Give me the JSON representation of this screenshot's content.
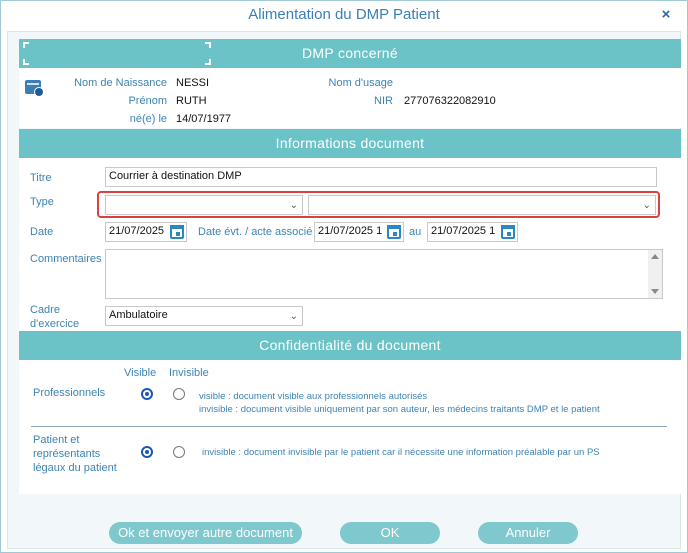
{
  "window": {
    "title": "Alimentation du DMP Patient",
    "close_glyph": "×"
  },
  "dmp": {
    "header": "DMP concerné",
    "labels": {
      "nom_naissance": "Nom de Naissance",
      "prenom": "Prénom",
      "ne_le": "né(e) le",
      "nom_usage": "Nom d'usage",
      "nir": "NIR"
    },
    "values": {
      "nom_naissance": "NESSI",
      "prenom": "RUTH",
      "ne_le": "14/07/1977",
      "nom_usage": "",
      "nir": "277076322082910"
    }
  },
  "doc": {
    "header": "Informations document",
    "titre_label": "Titre",
    "titre_value": "Courrier à destination DMP",
    "type_label": "Type",
    "type_value_1": "",
    "type_value_2": "",
    "date_label": "Date",
    "date_value": "21/07/2025",
    "date_evt_label": "Date évt. / acte associé",
    "date_evt_from": "21/07/2025 1",
    "au_label": "au",
    "date_evt_to": "21/07/2025 1",
    "commentaires_label": "Commentaires",
    "commentaires_value": "",
    "cadre_label_1": "Cadre",
    "cadre_label_2": "d'exercice",
    "cadre_value": "Ambulatoire"
  },
  "conf": {
    "header": "Confidentialité du document",
    "col_visible": "Visible",
    "col_invisible": "Invisible",
    "professionnels_label": "Professionnels",
    "prof_desc_1": "visible : document visible aux professionnels autorisés",
    "prof_desc_2": "invisible : document visible uniquement par son auteur, les médecins traitants DMP et le patient",
    "patient_label_1": "Patient et",
    "patient_label_2": "représentants",
    "patient_label_3": "légaux du patient",
    "patient_desc": "invisible : document invisible par le patient car il nécessite une information préalable par un PS"
  },
  "buttons": {
    "ok_send": "Ok et envoyer autre document",
    "ok": "OK",
    "cancel": "Annuler"
  },
  "colors": {
    "accent": "#6bc3c7",
    "label_blue": "#3c84b4",
    "title_blue": "#3a7fb5",
    "highlight_red": "#d9423f"
  },
  "icons": {
    "close": "close-icon",
    "patient": "patient-card-icon",
    "calendar": "calendar-icon",
    "chevron": "chevron-down-icon"
  }
}
